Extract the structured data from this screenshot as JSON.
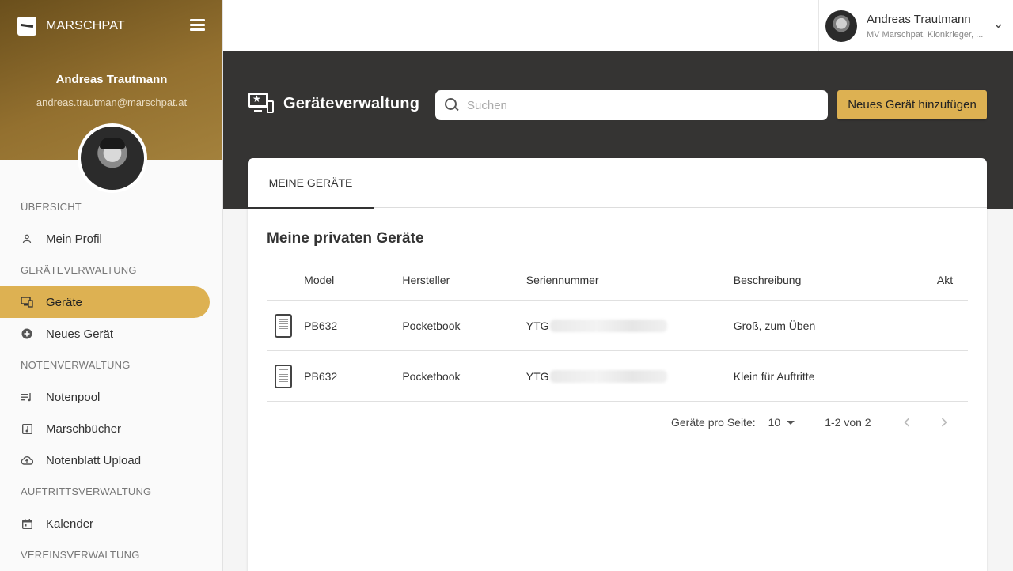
{
  "brand": {
    "name": "MARSCHPAT"
  },
  "sidebar_user": {
    "name": "Andreas Trautmann",
    "email": "andreas.trautman@marschpat.at"
  },
  "topbar_user": {
    "name": "Andreas Trautmann",
    "subtitle": "MV Marschpat, Klonkrieger, ..."
  },
  "nav": {
    "sec_overview": "ÜBERSICHT",
    "my_profile": "Mein Profil",
    "sec_devices": "GERÄTEVERWALTUNG",
    "devices": "Geräte",
    "new_device": "Neues Gerät",
    "sec_notes": "NOTENVERWALTUNG",
    "notepool": "Notenpool",
    "marchbooks": "Marschbücher",
    "sheet_upload": "Notenblatt Upload",
    "sec_performances": "AUFTRITTSVERWALTUNG",
    "calendar": "Kalender",
    "sec_club": "VEREINSVERWALTUNG"
  },
  "header": {
    "title": "Geräteverwaltung",
    "search_placeholder": "Suchen",
    "add_button": "Neues Gerät hinzufügen"
  },
  "tabs": {
    "my_devices": "MEINE GERÄTE"
  },
  "section_title": "Meine privaten Geräte",
  "table": {
    "columns": [
      "Model",
      "Hersteller",
      "Seriennummer",
      "Beschreibung",
      "Akt"
    ],
    "rows": [
      {
        "model": "PB632",
        "manufacturer": "Pocketbook",
        "serial_prefix": "YTG",
        "description": "Groß, zum Üben"
      },
      {
        "model": "PB632",
        "manufacturer": "Pocketbook",
        "serial_prefix": "YTG",
        "description": "Klein für Auftritte"
      }
    ]
  },
  "pagination": {
    "per_page_label": "Geräte pro Seite:",
    "per_page_value": "10",
    "range": "1-2 von 2"
  },
  "colors": {
    "accent": "#ddb152",
    "band": "#353433",
    "header_gradient_start": "#6a4f1c",
    "header_gradient_end": "#a3813c"
  }
}
